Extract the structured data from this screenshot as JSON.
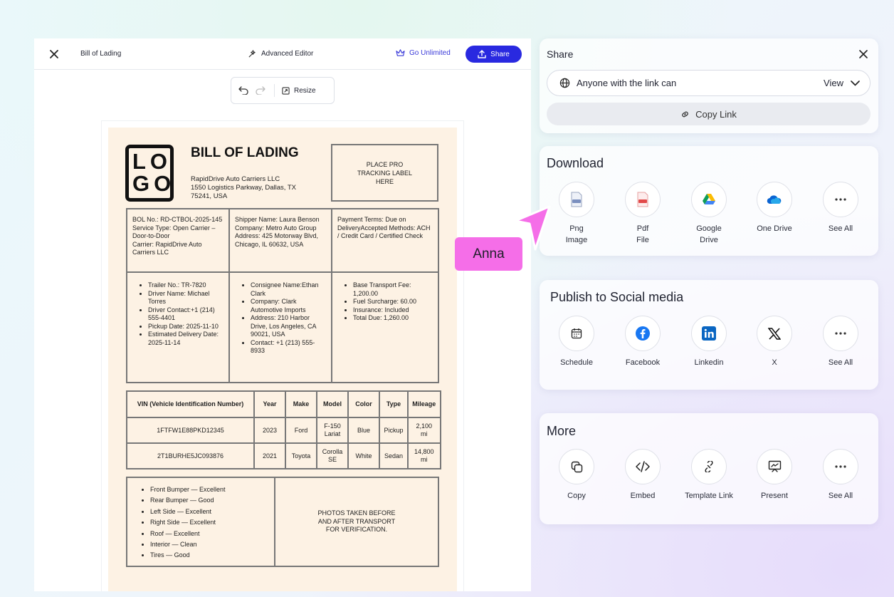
{
  "editor": {
    "doc_title": "Bill of Lading",
    "advanced_editor": "Advanced Editor",
    "go_unlimited": "Go Unlimited",
    "share_label": "Share",
    "resize_label": "Resize"
  },
  "doc": {
    "logo": "LOGO",
    "title": "BILL OF LADING",
    "company": "RapidDrive Auto Carriers LLC",
    "address": "1550 Logistics Parkway, Dallas, TX 75241, USA",
    "pro_label": "PLACE PRO TRACKING LABEL HERE",
    "bol_info": [
      "BOL No.: RD-CTBOL-2025-145",
      "Service Type: Open Carrier – Door-to-Door",
      "Carrier: RapidDrive Auto Carriers LLC"
    ],
    "shipper_info": [
      "Shipper Name: Laura Benson",
      "Company: Metro Auto Group",
      "Address: 425 Motorway Blvd, Chicago, IL 60632, USA"
    ],
    "payment_info": [
      "Payment Terms: Due on DeliveryAccepted Methods: ACH / Credit Card / Certified Check"
    ],
    "driver_list": [
      "Trailer No.: TR-7820",
      "Driver Name: Michael Torres",
      "Driver Contact:+1 (214) 555-4401",
      "Pickup Date: 2025-11-10",
      "Estimated Delivery Date: 2025-11-14"
    ],
    "consignee_list": [
      "Consignee Name:Ethan Clark",
      "Company: Clark Automotive Imports",
      "Address: 210 Harbor Drive, Los Angeles, CA 90021, USA",
      "Contact: +1 (213) 555-8933"
    ],
    "charges_list": [
      "Base Transport Fee: 1,200.00",
      "Fuel Surcharge: 60.00",
      "Insurance: Included",
      "Total Due: 1,260.00"
    ],
    "vehicle_headers": [
      "VIN (Vehicle Identification Number)",
      "Year",
      "Make",
      "Model",
      "Color",
      "Type",
      "Mileage"
    ],
    "vehicles": [
      [
        "1FTFW1E88PKD12345",
        "2023",
        "Ford",
        "F-150 Lariat",
        "Blue",
        "Pickup",
        "2,100 mi"
      ],
      [
        "2T1BURHE5JC093876",
        "2021",
        "Toyota",
        "Corolla SE",
        "White",
        "Sedan",
        "14,800 mi"
      ]
    ],
    "condition_list": [
      "Front Bumper — Excellent",
      "Rear Bumper — Good",
      "Left Side — Excellent",
      "Right Side — Excellent",
      "Roof — Excellent",
      "Interior — Clean",
      "Tires — Good"
    ],
    "photos_note": "PHOTOS TAKEN BEFORE AND AFTER TRANSPORT FOR VERIFICATION."
  },
  "share": {
    "title": "Share",
    "permission_label": "Anyone with the link can",
    "permission_value": "View",
    "copy_link": "Copy Link"
  },
  "download": {
    "title": "Download",
    "items": [
      {
        "label": "Png Image",
        "icon": "png-file-icon"
      },
      {
        "label": "Pdf File",
        "icon": "pdf-file-icon"
      },
      {
        "label": "Google Drive",
        "icon": "google-drive-icon"
      },
      {
        "label": "One Drive",
        "icon": "onedrive-icon"
      },
      {
        "label": "See All",
        "icon": "more-icon"
      }
    ]
  },
  "publish": {
    "title": "Publish to Social media",
    "items": [
      {
        "label": "Schedule",
        "icon": "calendar-icon"
      },
      {
        "label": "Facebook",
        "icon": "facebook-icon"
      },
      {
        "label": "Linkedin",
        "icon": "linkedin-icon"
      },
      {
        "label": "X",
        "icon": "x-logo-icon"
      },
      {
        "label": "See All",
        "icon": "more-icon"
      }
    ]
  },
  "more": {
    "title": "More",
    "items": [
      {
        "label": "Copy",
        "icon": "copy-icon"
      },
      {
        "label": "Embed",
        "icon": "code-icon"
      },
      {
        "label": "Template Link",
        "icon": "link-icon"
      },
      {
        "label": "Present",
        "icon": "presentation-icon"
      },
      {
        "label": "See All",
        "icon": "more-icon"
      }
    ]
  },
  "collaborator": {
    "name": "Anna"
  },
  "colors": {
    "accent": "#2929e0",
    "cursor": "#f56ee8",
    "paper": "#fdf2e4"
  }
}
